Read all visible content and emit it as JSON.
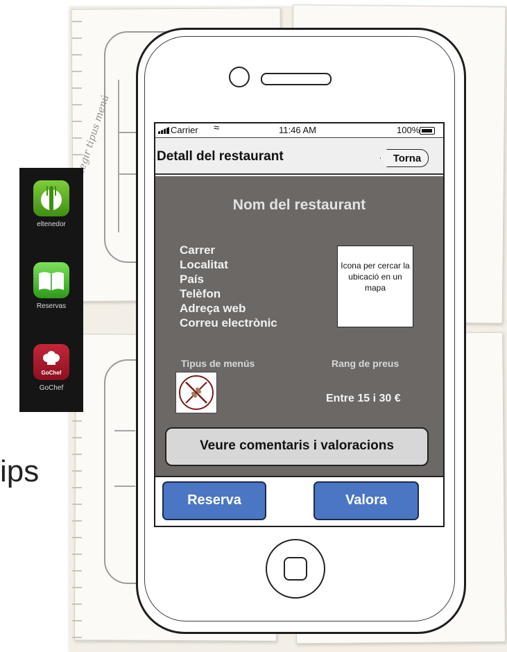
{
  "apps": [
    {
      "label": "eltenedor",
      "icon": "fork-icon"
    },
    {
      "label": "Reservas",
      "icon": "book-icon"
    },
    {
      "label": "GoChef",
      "icon": "chef-hat-icon",
      "badge": "GoChef"
    }
  ],
  "slide_text": "ips",
  "sketch_note": "llegir tipus menú",
  "status_bar": {
    "carrier": "Carrier",
    "time": "11:46 AM",
    "battery": "100%"
  },
  "nav": {
    "title": "Detall del restaurant",
    "back_label": "Torna"
  },
  "restaurant": {
    "name": "Nom del restaurant",
    "info": [
      "Carrer",
      "Localitat",
      "País",
      "Telèfon",
      "Adreça web",
      "Correu electrònic"
    ],
    "map_placeholder": "Icona per cercar la ubicació en un mapa",
    "menus_label": "Tipus de menús",
    "price_label": "Rang de preus",
    "price_range": "Entre 15 i 30 €"
  },
  "actions": {
    "reviews": "Veure comentaris i valoracions",
    "reserve": "Reserva",
    "rate": "Valora"
  },
  "colors": {
    "content_bg": "#6b6866",
    "button_blue": "#4a76c4"
  }
}
